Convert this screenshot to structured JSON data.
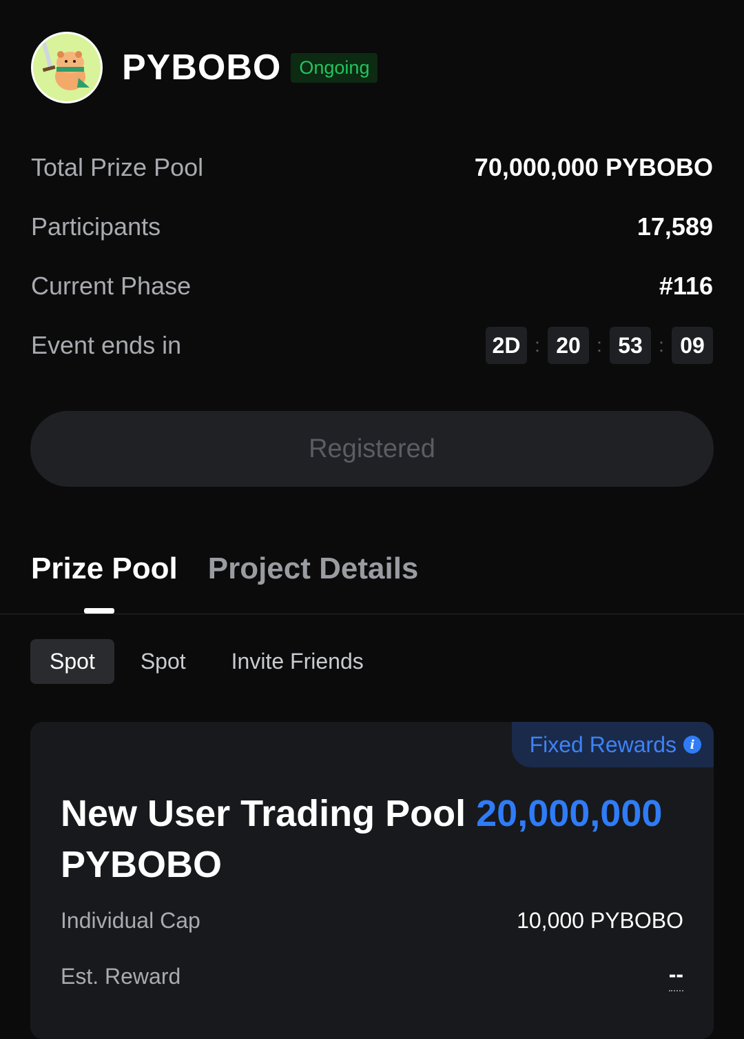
{
  "header": {
    "title": "PYBOBO",
    "status": "Ongoing",
    "avatar_icon": "capybara-warrior-icon",
    "status_color": "#22c55e"
  },
  "stats": {
    "total_prize_pool_label": "Total Prize Pool",
    "total_prize_pool_value": "70,000,000 PYBOBO",
    "participants_label": "Participants",
    "participants_value": "17,589",
    "current_phase_label": "Current Phase",
    "current_phase_value": "#116",
    "event_ends_label": "Event ends in",
    "countdown": {
      "days": "2D",
      "hours": "20",
      "minutes": "53",
      "seconds": "09",
      "separator": ":"
    }
  },
  "register_button": "Registered",
  "tabs": {
    "prize_pool": "Prize Pool",
    "project_details": "Project Details"
  },
  "subtabs": {
    "spot_1": "Spot",
    "spot_2": "Spot",
    "invite": "Invite Friends"
  },
  "card": {
    "tag": "Fixed Rewards",
    "info_icon": "i",
    "title_prefix": "New User Trading Pool",
    "title_amount": "20,000,000",
    "title_suffix": "PYBOBO",
    "individual_cap_label": "Individual Cap",
    "individual_cap_value": "10,000 PYBOBO",
    "est_reward_label": "Est. Reward",
    "est_reward_value": "--",
    "accent_color": "#2f7cf6"
  }
}
